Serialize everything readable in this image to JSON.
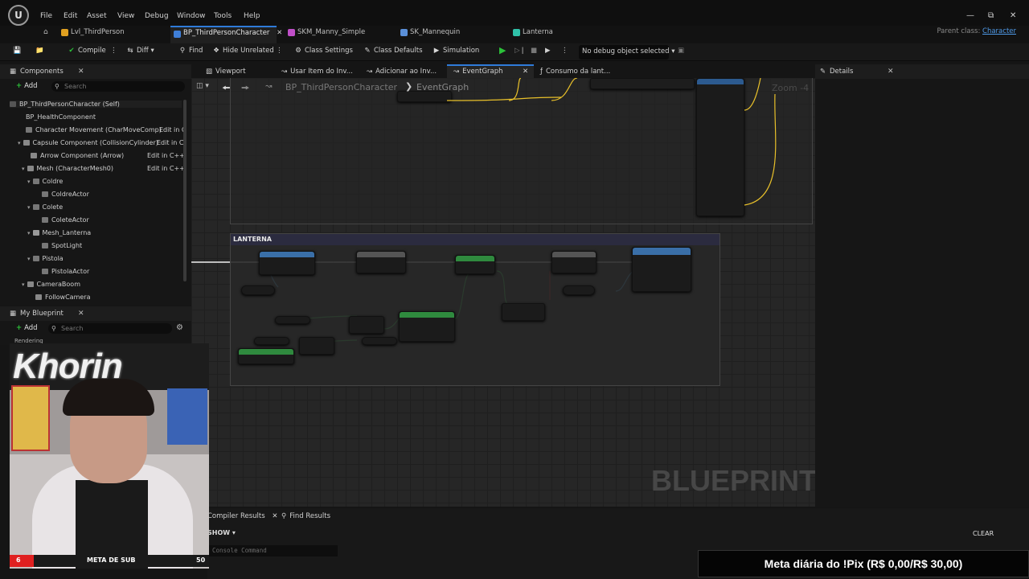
{
  "menu": [
    "File",
    "Edit",
    "Asset",
    "View",
    "Debug",
    "Window",
    "Tools",
    "Help"
  ],
  "tabs": [
    {
      "label": "Lvl_ThirdPerson",
      "color": "#e0a020"
    },
    {
      "label": "BP_ThirdPersonCharacter",
      "color": "#3f7fd8"
    },
    {
      "label": "SKM_Manny_Simple",
      "color": "#c04fc8"
    },
    {
      "label": "SK_Mannequin",
      "color": "#5a8fd8"
    },
    {
      "label": "Lanterna",
      "color": "#2fc0a8"
    }
  ],
  "parent_class": {
    "label": "Parent class:",
    "value": "Character"
  },
  "toolbar": {
    "compile": "Compile",
    "diff": "Diff",
    "find": "Find",
    "hide_unrelated": "Hide Unrelated",
    "class_settings": "Class Settings",
    "class_defaults": "Class Defaults",
    "simulation": "Simulation",
    "debug_object": "No debug object selected"
  },
  "components_panel": {
    "title": "Components",
    "add": "Add",
    "search_placeholder": "Search",
    "items": [
      {
        "label": "BP_ThirdPersonCharacter (Self)"
      },
      {
        "label": "BP_HealthComponent"
      },
      {
        "label": "Character Movement (CharMoveComp)",
        "edit": "Edit in C"
      },
      {
        "label": "Capsule Component (CollisionCylinder)",
        "edit": "Edit in C"
      },
      {
        "label": "Arrow Component (Arrow)",
        "edit": "Edit in C++"
      },
      {
        "label": "Mesh (CharacterMesh0)",
        "edit": "Edit in C++"
      },
      {
        "label": "Coldre"
      },
      {
        "label": "ColdreActor"
      },
      {
        "label": "Colete"
      },
      {
        "label": "ColeteActor"
      },
      {
        "label": "Mesh_Lanterna"
      },
      {
        "label": "SpotLight"
      },
      {
        "label": "Pistola"
      },
      {
        "label": "PistolaActor"
      },
      {
        "label": "CameraBoom"
      },
      {
        "label": "FollowCamera"
      }
    ]
  },
  "my_blueprint": {
    "title": "My Blueprint",
    "add": "Add",
    "search_placeholder": "Search",
    "section": "Rendering"
  },
  "graph_tabs": [
    "Viewport",
    "Usar Item do Inv...",
    "Adicionar ao Inv...",
    "EventGraph",
    "Consumo da lant..."
  ],
  "graph": {
    "breadcrumb_root": "BP_ThirdPersonCharacter",
    "breadcrumb_current": "EventGraph",
    "zoom": "Zoom -4",
    "comment_title": "LANTERNA",
    "watermark": "BLUEPRINT"
  },
  "details_panel": {
    "title": "Details"
  },
  "bottom": {
    "tabs": [
      "Compiler Results",
      "Find Results"
    ],
    "show": "SHOW",
    "console_placeholder": "Console Command",
    "clear": "CLEAR"
  },
  "stream_overlay": {
    "cam_sign": "Khorin",
    "goal_current": "6",
    "goal_label": "META DE SUB",
    "goal_target": "50",
    "goal_progress": 0.12,
    "pix_banner": "Meta diária do !Pix (R$ 0,00/R$ 30,00)"
  }
}
